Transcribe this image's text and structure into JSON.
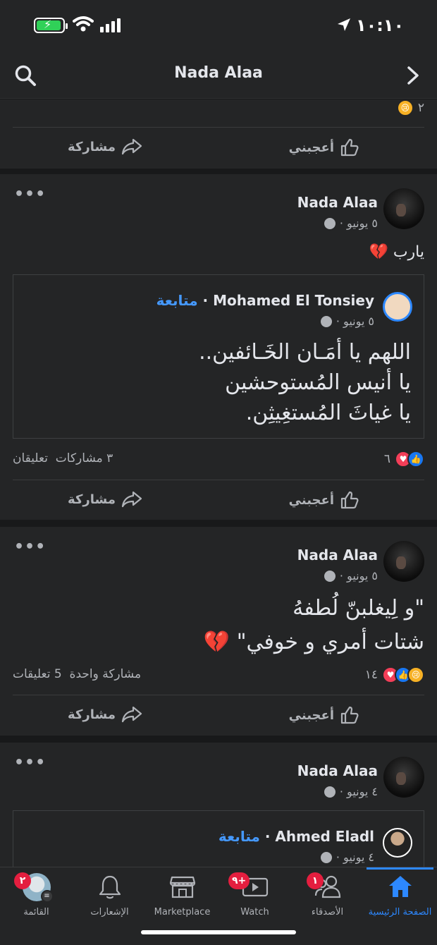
{
  "status_bar": {
    "time": "١٠:١٠"
  },
  "header": {
    "title": "Nada Alaa"
  },
  "feed": {
    "top_partial": {
      "reaction_count": "٢",
      "like_label": "أعجبني",
      "share_label": "مشاركة"
    },
    "post1": {
      "author": "Nada Alaa",
      "date": "٥ يونيو ·",
      "text": "يارب 💔",
      "shared": {
        "author": "Mohamed El Tonsiey",
        "follow_label": "متابعة",
        "separator": " · ",
        "date": "٥ يونيو ·",
        "lines": [
          "اللهم يا أمَـان الخَـائفين..",
          "يا أنيس المُستوحشين",
          "يا غياثَ المُستغِيثِن."
        ]
      },
      "reaction_count": "٦",
      "shares": "٣ مشاركات",
      "comments": "تعليقان",
      "like_label": "أعجبني",
      "share_label": "مشاركة"
    },
    "post2": {
      "author": "Nada Alaa",
      "date": "٥ يونيو ·",
      "lines": [
        "\"و لِيغلبنّ لُطفهُ",
        "شتات أمري و خوفي\" 💔"
      ],
      "reaction_count": "١٤",
      "shares": "مشاركة واحدة",
      "comments": "5 تعليقات",
      "like_label": "أعجبني",
      "share_label": "مشاركة"
    },
    "post3": {
      "author": "Nada Alaa",
      "date": "٤ يونيو ·",
      "shared": {
        "author": "Ahmed Eladl",
        "follow_label": "متابعة",
        "separator": " · ",
        "date": "٤ يونيو ·"
      }
    }
  },
  "tabbar": {
    "tabs": [
      {
        "label": "الصفحة الرئيسية"
      },
      {
        "label": "الأصدقاء",
        "badge": "١"
      },
      {
        "label": "Watch",
        "badge": "٩+"
      },
      {
        "label": "Marketplace"
      },
      {
        "label": "الإشعارات"
      },
      {
        "label": "القائمة",
        "badge": "٢"
      }
    ]
  },
  "colors": {
    "background": "#18191a",
    "card": "#242526",
    "accent": "#2d88ff",
    "follow": "#4599ff",
    "badge": "#e41e3f",
    "heart": "#f33e58"
  }
}
